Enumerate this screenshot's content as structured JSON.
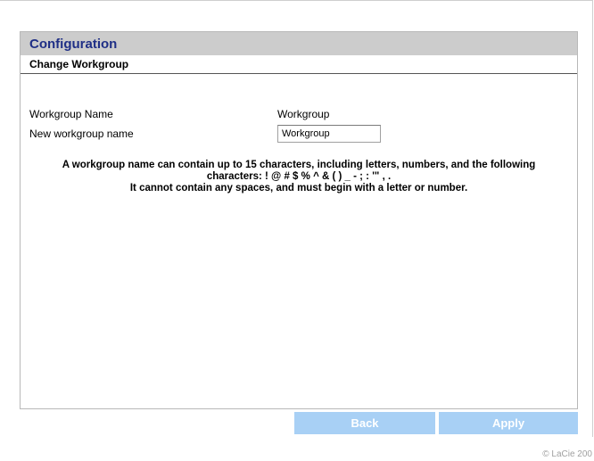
{
  "header": {
    "title": "Configuration"
  },
  "section": {
    "title": "Change Workgroup"
  },
  "form": {
    "current_label": "Workgroup Name",
    "current_value": "Workgroup",
    "new_label": "New workgroup name",
    "new_value": "Workgroup"
  },
  "help": {
    "line1": "A workgroup name can contain up to 15 characters, including letters, numbers, and the following",
    "line2": "characters: ! @ # $ % ^ & ( ) _ - ; : '\" , .",
    "line3": "It cannot contain any spaces, and must begin with a letter or number."
  },
  "buttons": {
    "back": "Back",
    "apply": "Apply"
  },
  "footer": {
    "copyright": "© LaCie 200"
  }
}
